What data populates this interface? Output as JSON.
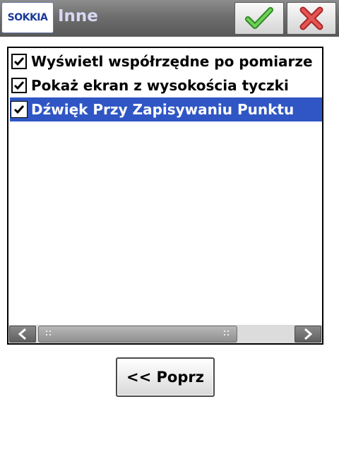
{
  "titlebar": {
    "logo_text": "SOKKIA",
    "title": "Inne",
    "ok_icon": "green-check-icon",
    "cancel_icon": "red-x-icon"
  },
  "options": [
    {
      "label": "Wyświetl współrzędne po pomiarze",
      "checked": true,
      "selected": false
    },
    {
      "label": "Pokaż ekran z wysokościa tyczki",
      "checked": true,
      "selected": false
    },
    {
      "label": "Dźwięk Przy Zapisywaniu Punktu",
      "checked": true,
      "selected": true
    }
  ],
  "footer": {
    "prev_label": "<< Poprz"
  },
  "colors": {
    "selection": "#2f56c4",
    "ok_green": "#4cae3c",
    "cancel_red": "#d93b3b",
    "title_text": "#d8d8f4"
  }
}
